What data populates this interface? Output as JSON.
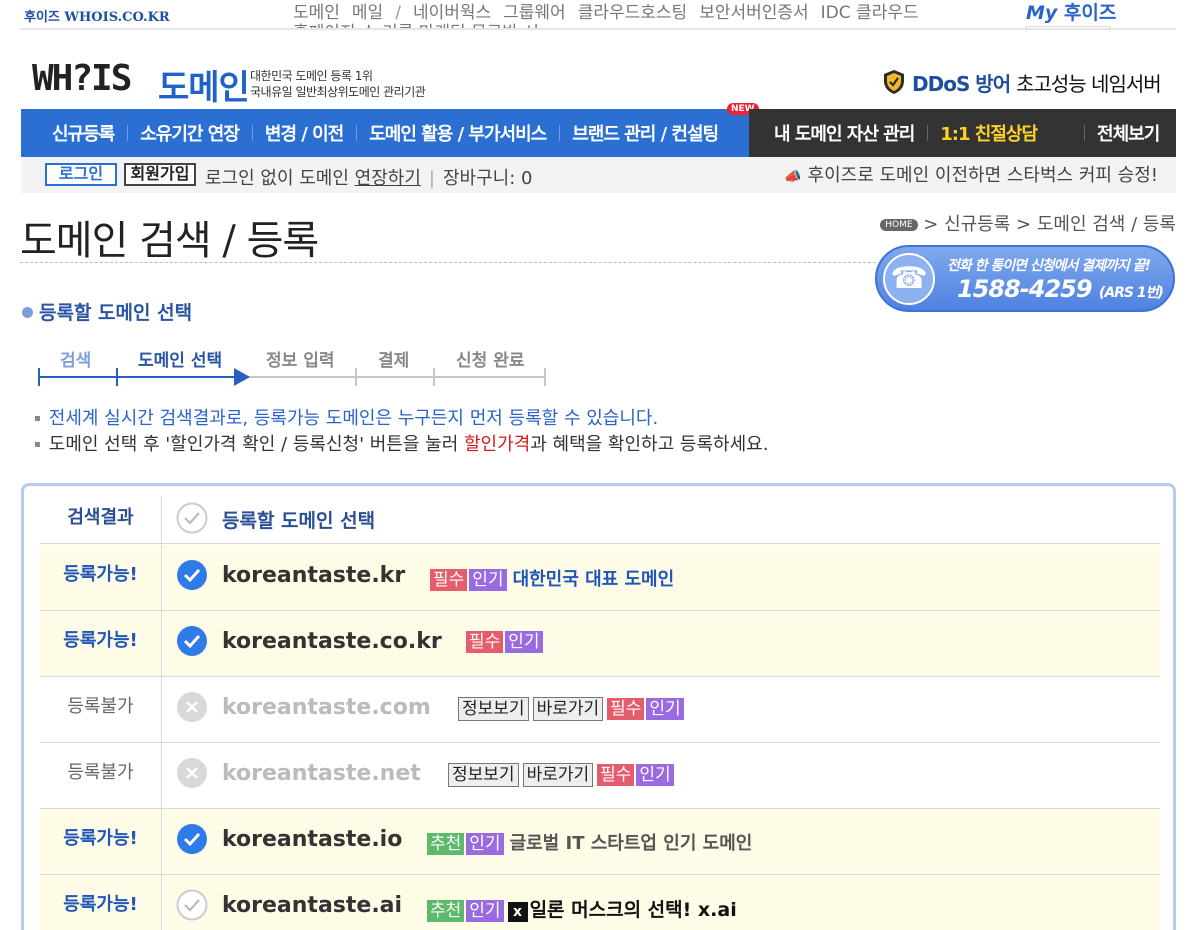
{
  "topbar": {
    "brand": "후이즈 WHOIS.CO.KR",
    "menu": [
      "도메인",
      "메일",
      "/",
      "네이버웍스",
      "그룹웨어",
      "클라우드호스팅",
      "보안서버인증서",
      "IDC 클라우드"
    ],
    "menu_line2": "홈페이지   스 기름   마케팅   무료반 시",
    "my_prefix": "My",
    "my_label": "후이즈"
  },
  "header": {
    "logo_latin": "WH?IS",
    "logo_korean": "도메인",
    "tagline_1": "대한민국 도메인 등록 1위",
    "tagline_2": "국내유일 일반최상위도메인 관리기관",
    "ddos_blue": "DDoS 방어",
    "ddos_black": "초고성능 네임서버"
  },
  "nav": {
    "items": [
      "신규등록",
      "소유기간 연장",
      "변경 / 이전",
      "도메인 활용 / 부가서비스",
      "브랜드 관리 / 컨설팅"
    ],
    "new_badge": "NEW",
    "dark_items": [
      "내 도메인 자산 관리",
      "1:1 친절상담"
    ],
    "all_view": "전체보기"
  },
  "loginbar": {
    "login": "로그인",
    "join": "회원가입",
    "text_prefix": "로그인 없이 도메인 ",
    "text_link": "연장하기",
    "cart": "장바구니: 0",
    "promo": "후이즈로 도메인 이전하면 스타벅스 커피 승정!"
  },
  "page": {
    "title": "도메인 검색 / 등록",
    "crumb_home": "HOME",
    "crumb_1": "신규등록",
    "crumb_2": "도메인 검색 / 등록",
    "phone_line1": "전화 한 통이면 신청에서 결제까지 끝!",
    "phone_number": "1588-4259",
    "phone_ars": "(ARS 1번)"
  },
  "section": {
    "heading": "등록할 도메인 선택",
    "steps": [
      "검색",
      "도메인 선택",
      "정보 입력",
      "결제",
      "신청 완료"
    ]
  },
  "notes": {
    "n1": "전세계 실시간 검색결과로, 등록가능 도메인은 누구든지 먼저 등록할 수 있습니다.",
    "n2_a": "도메인 선택 후 '할인가격 확인 / 등록신청' 버튼을 눌러 ",
    "n2_red": "할인가격",
    "n2_b": "과 혜택을 확인하고 등록하세요."
  },
  "results": {
    "col_status": "검색결과",
    "col_select": "등록할 도메인 선택",
    "rows": [
      {
        "status": "등록가능!",
        "domain": "koreantaste.kr",
        "tags": [
          "필수",
          "인기"
        ],
        "desc": "대한민국 대표 도메인",
        "checked": true
      },
      {
        "status": "등록가능!",
        "domain": "koreantaste.co.kr",
        "tags": [
          "필수",
          "인기"
        ],
        "desc": "",
        "checked": true
      },
      {
        "status": "등록불가",
        "domain": "koreantaste.com",
        "buttons": [
          "정보보기",
          "바로가기"
        ],
        "tags": [
          "필수",
          "인기"
        ],
        "checked": false
      },
      {
        "status": "등록불가",
        "domain": "koreantaste.net",
        "buttons": [
          "정보보기",
          "바로가기"
        ],
        "tags": [
          "필수",
          "인기"
        ],
        "checked": false
      },
      {
        "status": "등록가능!",
        "domain": "koreantaste.io",
        "tags": [
          "추천",
          "인기"
        ],
        "desc": "글로벌 IT 스타트업 인기 도메인",
        "checked": true
      },
      {
        "status": "등록가능!",
        "domain": "koreantaste.ai",
        "tags": [
          "추천",
          "인기"
        ],
        "desc": "일론 머스크의 선택! x.ai",
        "checked": false
      }
    ]
  },
  "colors": {
    "brand_blue": "#2b6fd3",
    "dark_nav": "#333333",
    "highlight_row": "#fefbe6",
    "tag_red": "#e55c6c",
    "tag_purple": "#9a6be0",
    "tag_green": "#5cba6a"
  }
}
